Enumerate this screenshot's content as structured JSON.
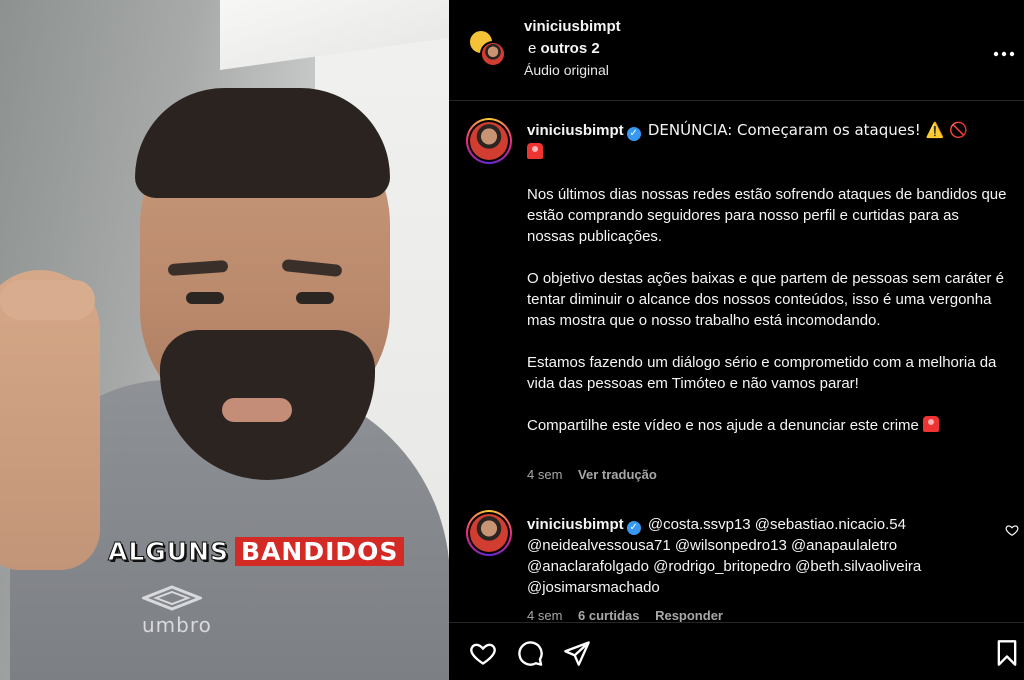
{
  "video": {
    "caption_word1": "ALGUNS",
    "caption_word2": "BANDIDOS",
    "shirt_logo": "umbro"
  },
  "header": {
    "username": "viniciusbimpt",
    "collaborators_prefix": "e",
    "collaborators": "outros 2",
    "audio": "Áudio original",
    "more_icon": "more-options-icon"
  },
  "caption": {
    "username": "viniciusbimpt",
    "line1": "DENÚNCIA: Começaram os ataques! ⚠️ 🚫",
    "p1": "Nos últimos dias nossas redes estão sofrendo ataques de bandidos que estão comprando seguidores para nosso perfil e curtidas para as nossas publicações.",
    "p2": "O objetivo destas ações baixas e que partem de pessoas sem caráter é tentar diminuir o alcance dos nossos conteúdos, isso é uma vergonha mas mostra que o nosso trabalho está incomodando.",
    "p3": "Estamos fazendo um diálogo sério e comprometido com a melhoria da vida das pessoas em Timóteo e não vamos parar!",
    "p4": "Compartilhe este vídeo e nos ajude a denunciar este crime",
    "time": "4 sem",
    "translate": "Ver tradução"
  },
  "comment": {
    "username": "viniciusbimpt",
    "text": "@costa.ssvp13 @sebastiao.nicacio.54 @neidealvessousa71 @wilsonpedro13 @anapaulaletro @anaclarafolgado @rodrigo_britopedro @beth.silvaoliveira @josimarsmachado",
    "time": "4 sem",
    "likes": "6 curtidas",
    "reply": "Responder"
  },
  "colors": {
    "background": "#000000",
    "verified": "#3897f0",
    "muted": "#a8a8a8",
    "caption_red": "#d42a26"
  }
}
